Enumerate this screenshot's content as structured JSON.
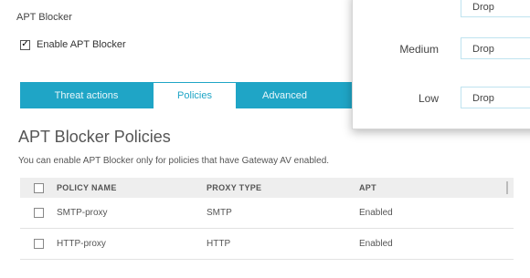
{
  "section_title": "APT Blocker",
  "enable_checkbox": {
    "label": "Enable APT Blocker",
    "checked": true
  },
  "tabs": [
    {
      "label": "Threat actions",
      "active": false
    },
    {
      "label": "Policies",
      "active": true
    },
    {
      "label": "Advanced",
      "active": false
    }
  ],
  "policies": {
    "heading": "APT Blocker Policies",
    "note": "You can enable APT Blocker only for policies that have Gateway AV enabled.",
    "columns": [
      "POLICY NAME",
      "PROXY TYPE",
      "APT"
    ],
    "rows": [
      {
        "name": "SMTP-proxy",
        "type": "SMTP",
        "apt": "Enabled"
      },
      {
        "name": "HTTP-proxy",
        "type": "HTTP",
        "apt": "Enabled"
      }
    ]
  },
  "threat_popup": {
    "rows": [
      {
        "label": "",
        "value": "Drop"
      },
      {
        "label": "Medium",
        "value": "Drop"
      },
      {
        "label": "Low",
        "value": "Drop"
      }
    ]
  },
  "colors": {
    "accent": "#1fa5c6"
  }
}
